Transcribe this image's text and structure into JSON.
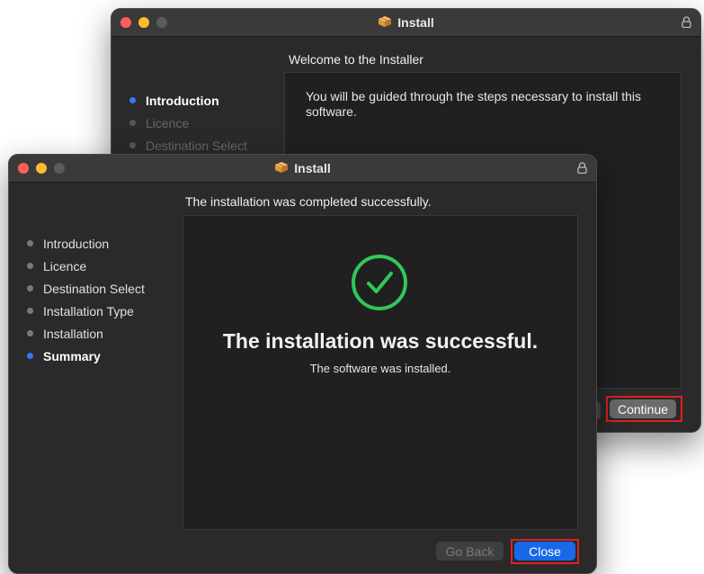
{
  "back_window": {
    "title": "Install",
    "heading": "Welcome to the  Installer",
    "sidebar": [
      {
        "label": "Introduction",
        "state": "active"
      },
      {
        "label": "Licence",
        "state": "dim"
      },
      {
        "label": "Destination Select",
        "state": "dim"
      }
    ],
    "body_text": "You will be guided through the steps necessary to install this software.",
    "continue_label": "Continue"
  },
  "front_window": {
    "title": "Install",
    "heading": "The installation was completed successfully.",
    "sidebar": [
      {
        "label": "Introduction",
        "state": "normal"
      },
      {
        "label": "Licence",
        "state": "normal"
      },
      {
        "label": "Destination Select",
        "state": "normal"
      },
      {
        "label": "Installation Type",
        "state": "normal"
      },
      {
        "label": "Installation",
        "state": "normal"
      },
      {
        "label": "Summary",
        "state": "active"
      }
    ],
    "success_title": "The installation was successful.",
    "success_subtitle": "The software was installed.",
    "go_back_label": "Go Back",
    "close_label": "Close"
  },
  "colors": {
    "accent_blue": "#2f7bf5",
    "success_green": "#32c759",
    "highlight_red": "#e02020"
  },
  "icons": [
    "package-icon",
    "lock-icon",
    "checkmark-circle-icon"
  ]
}
